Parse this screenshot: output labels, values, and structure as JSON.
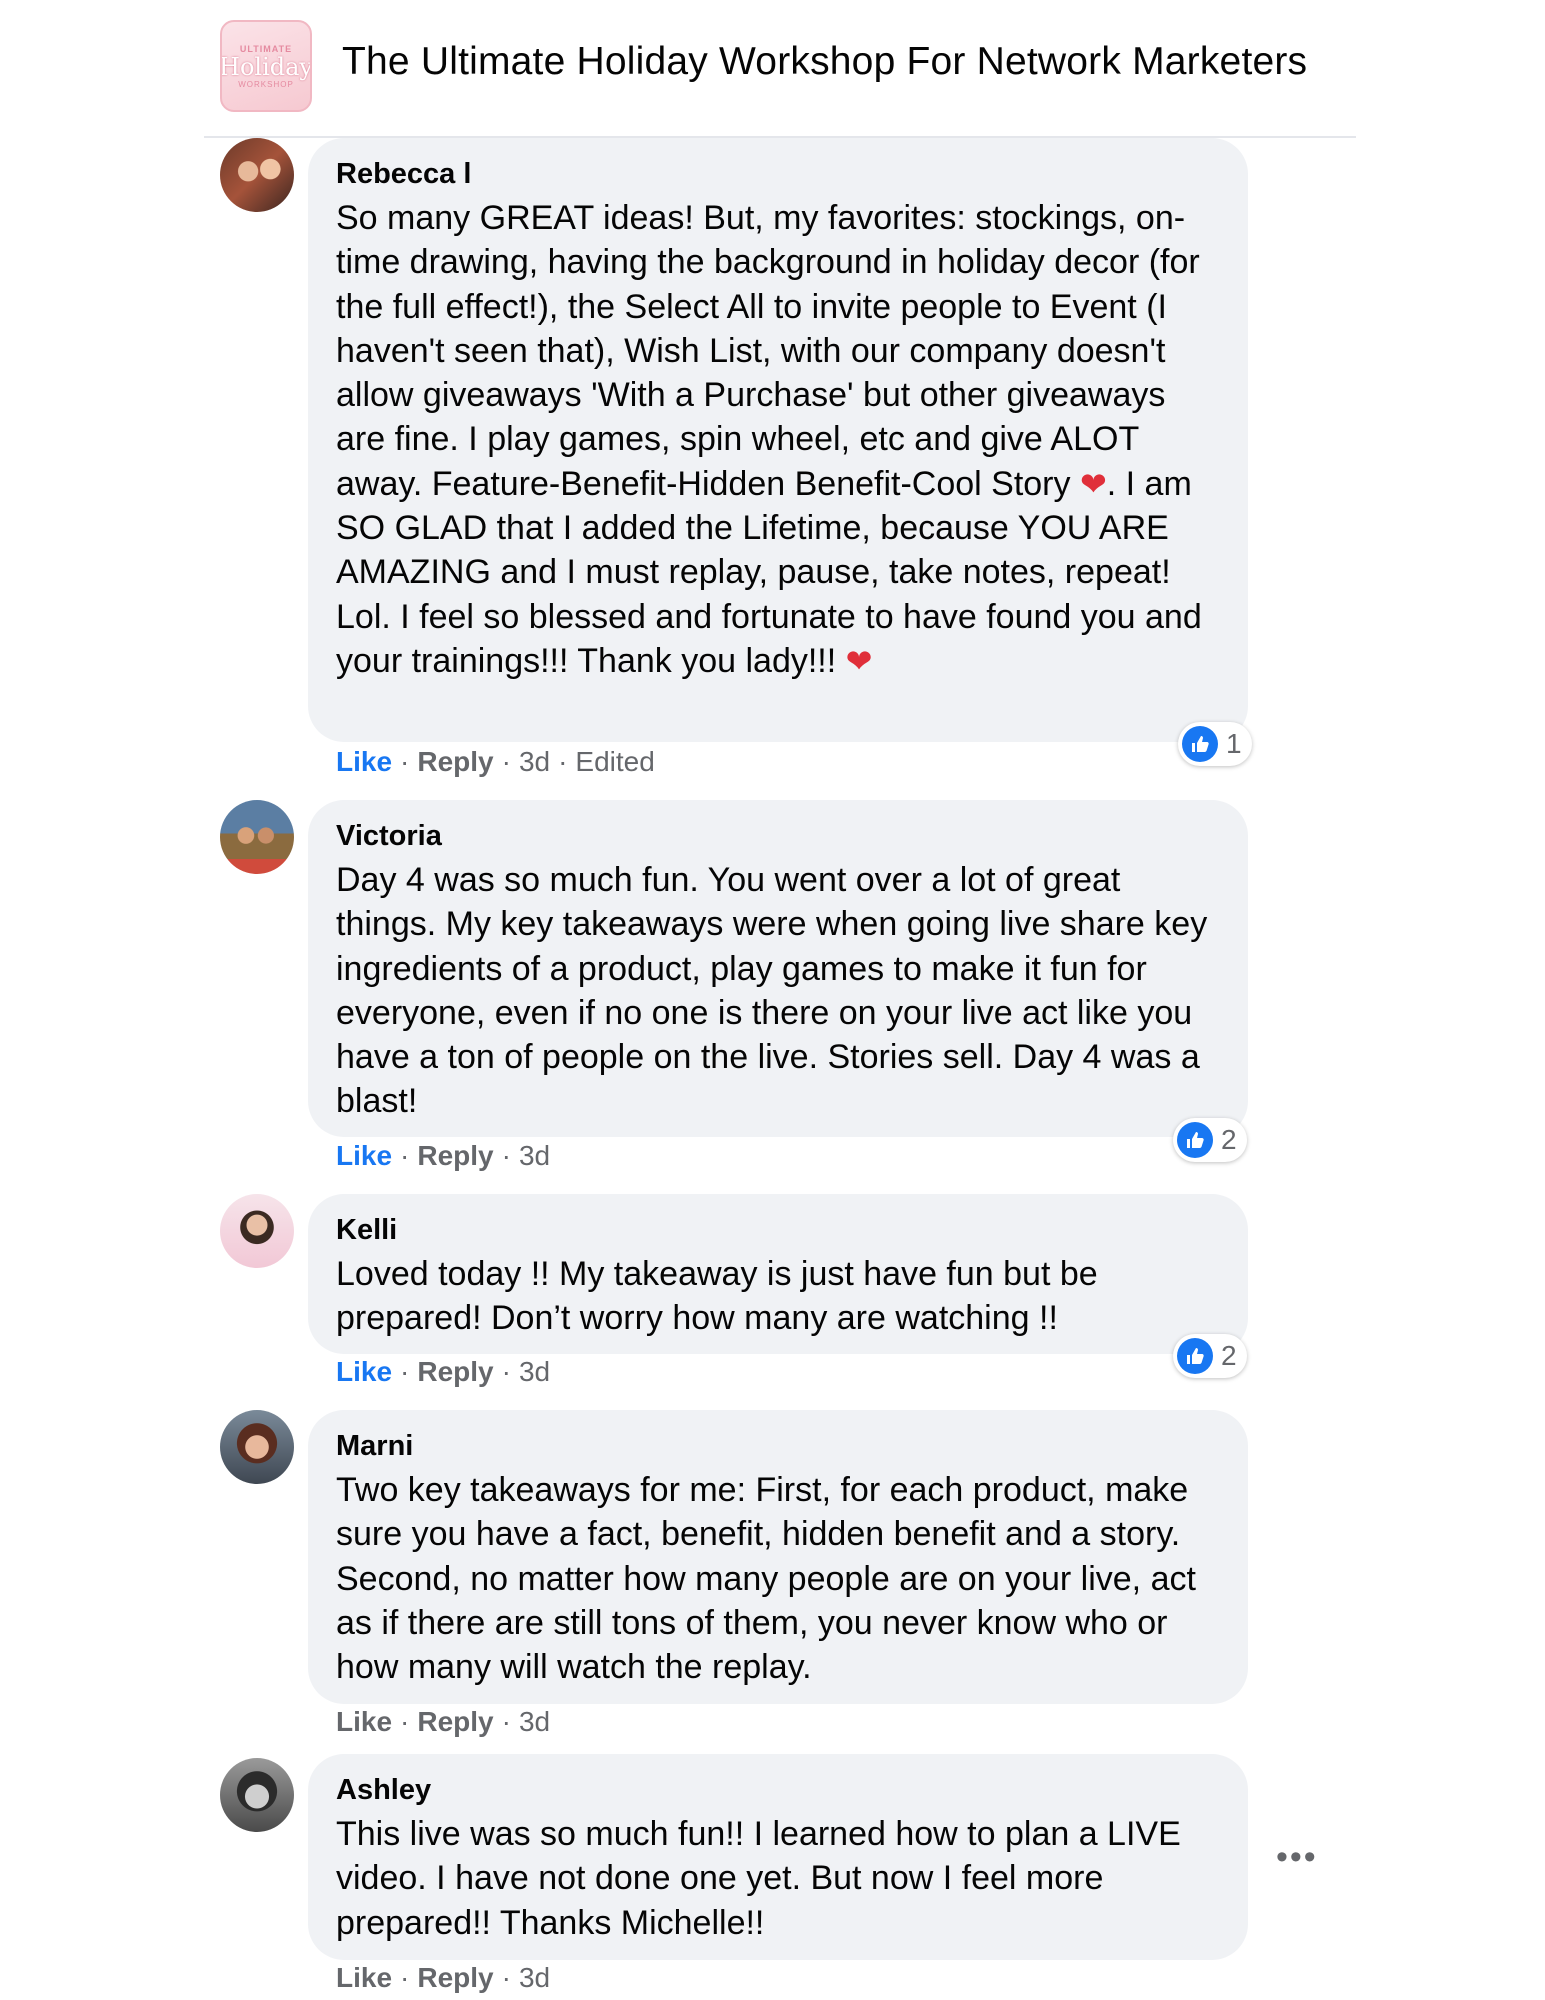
{
  "header": {
    "group_title": "The Ultimate Holiday Workshop For Network Marketers",
    "thumb_top": "ULTIMATE",
    "thumb_mid": "Holiday",
    "thumb_bot": "WORKSHOP"
  },
  "comments": [
    {
      "author": "Rebecca l",
      "text_1": "So many GREAT ideas! But, my favorites: stockings, on-time drawing, having the background in holiday decor (for the full effect!), the Select All to invite people to Event (I haven't seen that), Wish List, with our company doesn't allow giveaways 'With a Purchase' but other giveaways are fine. I play games, spin wheel, etc and give ALOT away. Feature-Benefit-Hidden Benefit-Cool Story ",
      "text_2": ". I am SO GLAD that I added the Lifetime, because YOU ARE AMAZING and I must replay, pause, take notes, repeat! Lol. I feel so blessed and fortunate to have found you and your trainings!!! Thank you lady!!! ",
      "like": "Like",
      "reply": "Reply",
      "time": "3d",
      "edited": "Edited",
      "reactions": "1"
    },
    {
      "author": "Victoria",
      "text": "Day 4 was so much fun. You went over a lot of great things. My key takeaways were when going live share key ingredients of a product, play games to make it fun for everyone, even if no one is there on your live act like you have a ton of people on the live. Stories sell. Day 4 was a blast!",
      "like": "Like",
      "reply": "Reply",
      "time": "3d",
      "reactions": "2"
    },
    {
      "author": "Kelli",
      "text": "Loved today !! My takeaway is just have fun but be prepared! Don’t worry how many are watching !!",
      "like": "Like",
      "reply": "Reply",
      "time": "3d",
      "reactions": "2"
    },
    {
      "author": "Marni",
      "text": "Two key takeaways for me: First, for each product, make sure you have a fact, benefit, hidden benefit and a story. Second, no matter how many people are on your live, act as if there are still tons of them, you never know who or how many will watch the replay.",
      "like": "Like",
      "reply": "Reply",
      "time": "3d"
    },
    {
      "author": "Ashley",
      "text": "This live was so much fun!! I learned how to plan a LIVE video. I have not done one yet. But now I feel more prepared!! Thanks Michelle!!",
      "like": "Like",
      "reply": "Reply",
      "time": "3d"
    }
  ],
  "icons": {
    "heart": "heart-emoji",
    "like_reaction": "thumbs-up-icon",
    "more": "more-options-icon"
  },
  "colors": {
    "link_blue": "#1877f2",
    "bubble_bg": "#f0f2f5",
    "meta_gray": "#65676b",
    "heart_red": "#e02f3a"
  }
}
